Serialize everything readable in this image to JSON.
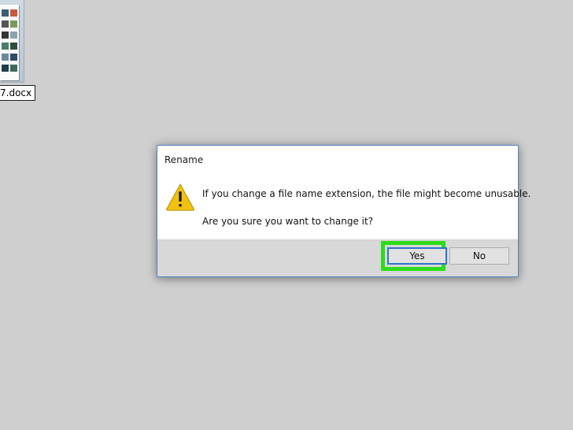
{
  "desktop": {
    "file": {
      "name": "7.docx",
      "icon": "word-document-icon"
    }
  },
  "dialog": {
    "title": "Rename",
    "icon": "warning-icon",
    "message_line1": "If you change a file name extension, the file might become unusable.",
    "message_line2": "Are you sure you want to change it?",
    "buttons": {
      "yes": "Yes",
      "no": "No"
    },
    "colors": {
      "border": "#4e83c2",
      "highlight": "#2ddc1a",
      "focus": "#2f74c8",
      "warning": "#f2c011"
    }
  }
}
